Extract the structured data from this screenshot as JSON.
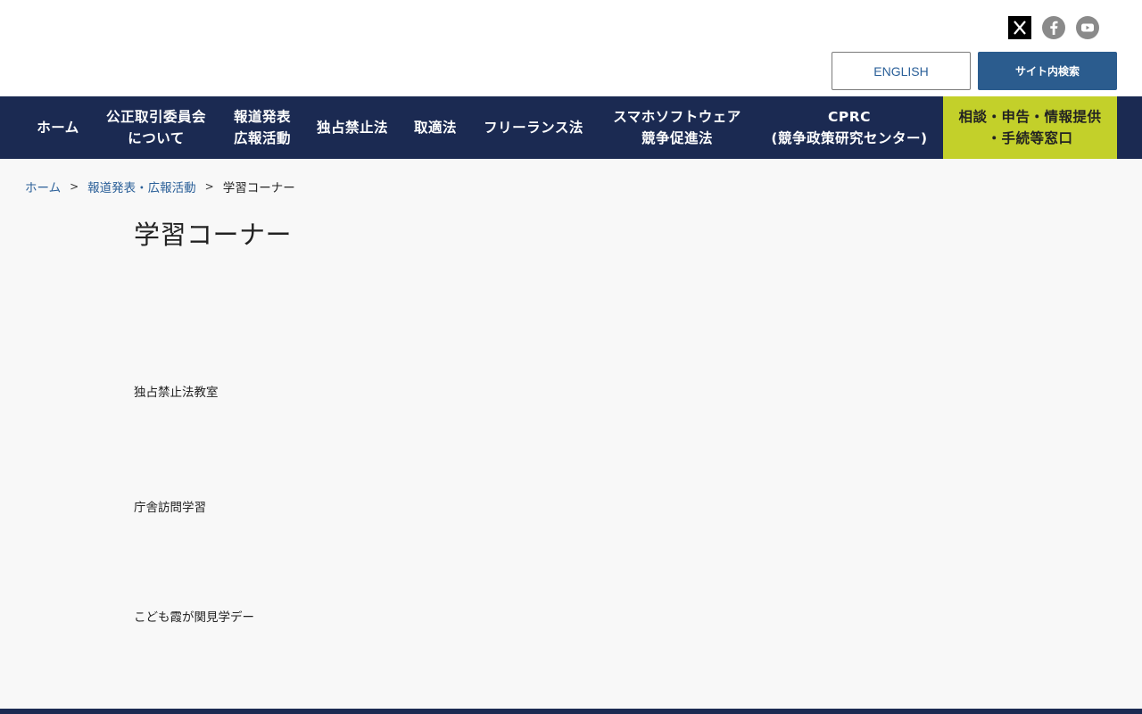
{
  "header": {
    "lang_label": "ENGLISH",
    "search_label": "サイト内検索",
    "social_icons": [
      "x-icon",
      "facebook-icon",
      "youtube-icon"
    ]
  },
  "nav": {
    "items": [
      {
        "lines": [
          "ホーム"
        ]
      },
      {
        "lines": [
          "公正取引委員会",
          "について"
        ]
      },
      {
        "lines": [
          "報道発表",
          "広報活動"
        ]
      },
      {
        "lines": [
          "独占禁止法"
        ]
      },
      {
        "lines": [
          "取適法"
        ]
      },
      {
        "lines": [
          "フリーランス法"
        ]
      },
      {
        "lines": [
          "スマホソフトウェア",
          "競争促進法"
        ]
      },
      {
        "lines": [
          "CPRC",
          "(競争政策研究センター)"
        ]
      }
    ],
    "consult": {
      "lines": [
        "相談・申告・情報提供",
        "・手続等窓口"
      ]
    }
  },
  "breadcrumb": {
    "home": "ホーム",
    "parent": "報道発表・広報活動",
    "current": "学習コーナー",
    "separator": ">"
  },
  "page": {
    "title": "学習コーナー",
    "sections": [
      {
        "label": "独占禁止法教室"
      },
      {
        "label": "庁舎訪問学習"
      },
      {
        "label": "こども霞が関見学デー"
      }
    ]
  },
  "colors": {
    "nav_bg": "#1b2a52",
    "consult_bg": "#c3d02a",
    "search_bg": "#2b5c8e",
    "link": "#2a5f98"
  }
}
